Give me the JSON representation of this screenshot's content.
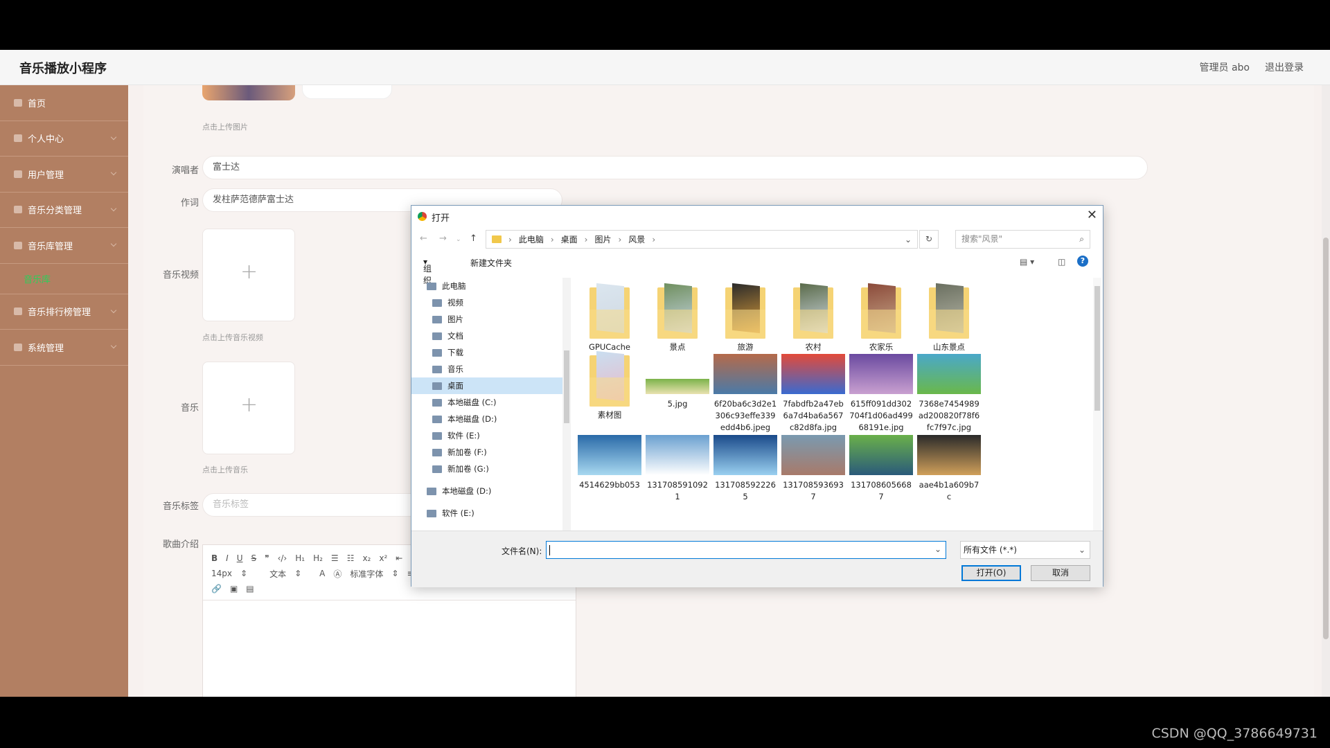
{
  "app": {
    "title": "音乐播放小程序",
    "admin": "管理员 abo",
    "logout": "退出登录"
  },
  "sidebar": {
    "items": [
      {
        "label": "首页"
      },
      {
        "label": "个人中心"
      },
      {
        "label": "用户管理"
      },
      {
        "label": "音乐分类管理"
      },
      {
        "label": "音乐库管理"
      },
      {
        "label": "音乐库"
      },
      {
        "label": "音乐排行榜管理"
      },
      {
        "label": "系统管理"
      }
    ]
  },
  "form": {
    "upload_image_hint": "点击上传图片",
    "singer_label": "演唱者",
    "singer_value": "富士达",
    "lyricist_label": "作词",
    "lyricist_value": "发柱萨范德萨富士达",
    "video_label": "音乐视频",
    "video_hint": "点击上传音乐视频",
    "music_label": "音乐",
    "music_hint": "点击上传音乐",
    "tag_label": "音乐标签",
    "tag_placeholder": "音乐标签",
    "intro_label": "歌曲介绍",
    "editor": {
      "font_size": "14px",
      "text_style": "文本",
      "font_family": "标准字体"
    }
  },
  "dialog": {
    "title": "打开",
    "breadcrumb": [
      "此电脑",
      "桌面",
      "图片",
      "风景"
    ],
    "search_placeholder": "搜索\"风景\"",
    "organize": "组织",
    "new_folder": "新建文件夹",
    "tree": [
      {
        "label": "此电脑",
        "level": 0
      },
      {
        "label": "视频",
        "level": 1
      },
      {
        "label": "图片",
        "level": 1
      },
      {
        "label": "文档",
        "level": 1
      },
      {
        "label": "下载",
        "level": 1
      },
      {
        "label": "音乐",
        "level": 1
      },
      {
        "label": "桌面",
        "level": 1,
        "selected": true
      },
      {
        "label": "本地磁盘 (C:)",
        "level": 1
      },
      {
        "label": "本地磁盘 (D:)",
        "level": 1
      },
      {
        "label": "软件 (E:)",
        "level": 1
      },
      {
        "label": "新加卷 (F:)",
        "level": 1
      },
      {
        "label": "新加卷 (G:)",
        "level": 1
      },
      {
        "label": "本地磁盘 (D:)",
        "level": 0
      },
      {
        "label": "软件 (E:)",
        "level": 0
      }
    ],
    "files": [
      {
        "name": "GPUCache",
        "kind": "folder"
      },
      {
        "name": "景点",
        "kind": "folder"
      },
      {
        "name": "旅游",
        "kind": "folder"
      },
      {
        "name": "农村",
        "kind": "folder"
      },
      {
        "name": "农家乐",
        "kind": "folder"
      },
      {
        "name": "山东景点",
        "kind": "folder"
      },
      {
        "name": "素材图",
        "kind": "folder"
      },
      {
        "name": "5.jpg",
        "kind": "photo"
      },
      {
        "name": "6f20ba6c3d2e1306c93effe339edd4b6.jpeg",
        "kind": "photo"
      },
      {
        "name": "7fabdfb2a47eb6a7d4ba6a567c82d8fa.jpg",
        "kind": "photo"
      },
      {
        "name": "615ff091dd302704f1d06ad49968191e.jpg",
        "kind": "photo"
      },
      {
        "name": "7368e7454989ad200820f78f6fc7f97c.jpg",
        "kind": "photo"
      },
      {
        "name": "4514629bb053",
        "kind": "photo"
      },
      {
        "name": "1317085910921",
        "kind": "photo"
      },
      {
        "name": "1317085922265",
        "kind": "photo"
      },
      {
        "name": "1317085936937",
        "kind": "photo"
      },
      {
        "name": "1317086056687",
        "kind": "photo"
      },
      {
        "name": "aae4b1a609b7c",
        "kind": "photo"
      }
    ],
    "filename_label": "文件名(N):",
    "filename_value": "",
    "filetype": "所有文件 (*.*)",
    "open_button": "打开(O)",
    "cancel_button": "取消"
  },
  "watermark": "CSDN @QQ_3786649731",
  "colors": {
    "sidebar": "#b27f62",
    "active_sub": "#2bd05a",
    "accent": "#0078d7"
  }
}
